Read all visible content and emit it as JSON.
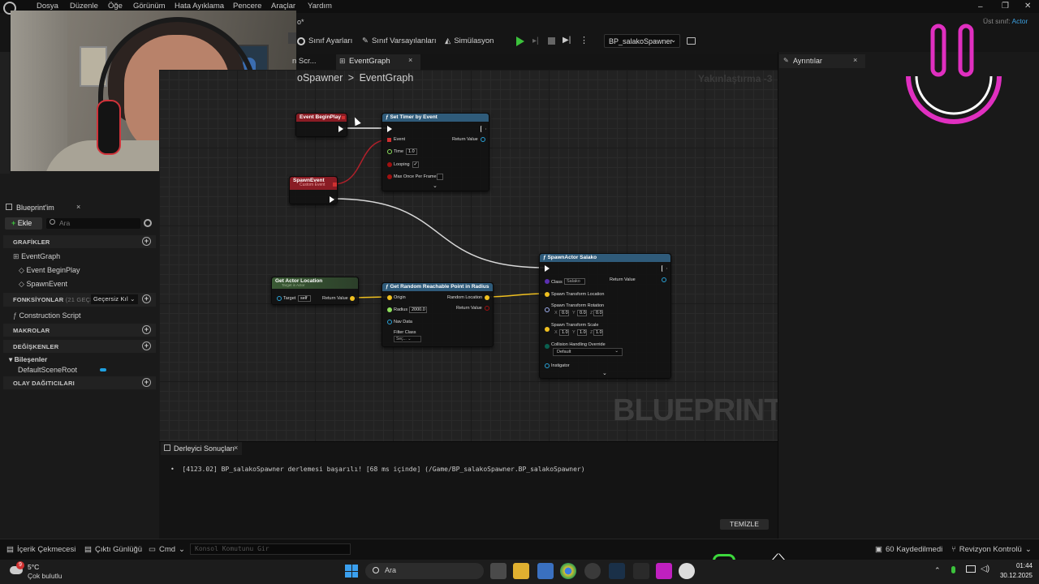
{
  "menu": [
    "Dosya",
    "Düzenle",
    "Öğe",
    "Görünüm",
    "Hata Ayıklama",
    "Pencere",
    "Araçlar",
    "Yardım"
  ],
  "parent_class": {
    "label": "Üst sınıf:",
    "value": "Actor"
  },
  "toolbar": {
    "class_settings": "Sınıf Ayarları",
    "class_defaults": "Sınıf Varsayılanları",
    "simulation": "Simülasyon",
    "blueprint_selector": "BP_salakoSpawner",
    "tab_title_partial": "o*"
  },
  "tabs": {
    "construction_partial": "n Scr...",
    "event_graph": "EventGraph",
    "details": "Ayrıntılar"
  },
  "breadcrumb": {
    "root": "oSpawner",
    "sep": ">",
    "current": "EventGraph"
  },
  "zoom_label": "Yakınlaştırma -3",
  "watermark": "BLUEPRINT",
  "my_blueprint": {
    "title": "Blueprint'im",
    "add_button": "Ekle",
    "search_placeholder": "Ara",
    "sections": {
      "graphs": "GRAFİKLER",
      "functions": "FONKSİYONLAR",
      "functions_count": "(21 GEÇERSİ",
      "override": "Geçersiz Kıl",
      "macros": "MAKROLAR",
      "variables": "DEĞİŞKENLER",
      "components": "Bileşenler",
      "dispatchers": "OLAY DAĞITICILARI"
    },
    "graph_items": [
      "EventGraph",
      "Event BeginPlay",
      "SpawnEvent"
    ],
    "function_items": [
      "Construction Script"
    ],
    "component_items": [
      "DefaultSceneRoot"
    ]
  },
  "nodes": {
    "begin_play": {
      "title": "Event BeginPlay"
    },
    "set_timer": {
      "title": "Set Timer by Event",
      "event": "Event",
      "time": "Time",
      "time_val": "1.0",
      "looping": "Looping",
      "max_once": "Max Once Per Frame",
      "return": "Return Value"
    },
    "spawn_event": {
      "title": "SpawnEvent",
      "subtitle": "Custom Event"
    },
    "get_actor_loc": {
      "title": "Get Actor Location",
      "subtitle": "Target is Actor",
      "target": "Target",
      "self": "self",
      "return": "Return Value"
    },
    "random_point": {
      "title": "Get Random Reachable Point in Radius",
      "origin": "Origin",
      "radius": "Radius",
      "radius_val": "2000.0",
      "nav_data": "Nav Data",
      "filter": "Filter Class",
      "filter_val": "Seç...",
      "random_loc": "Random Location",
      "return": "Return Value"
    },
    "spawn_actor": {
      "title": "SpawnActor Salako",
      "class": "Class",
      "class_val": "Salako",
      "loc": "Spawn Transform Location",
      "rot": "Spawn Transform Rotation",
      "scale": "Spawn Transform Scale",
      "rot_vals": [
        "0.0",
        "0.0",
        "0.0"
      ],
      "scale_vals": [
        "1.0",
        "1.0",
        "1.0"
      ],
      "axes": [
        "X",
        "Y",
        "Z"
      ],
      "collision": "Collision Handling Override",
      "collision_val": "Default",
      "instigator": "Instigator",
      "return": "Return Value"
    }
  },
  "compiler": {
    "title": "Derleyici Sonuçları",
    "message": "[4123.02] BP_salakoSpawner derlemesi başarılı! [68 ms içinde] (/Game/BP_salakoSpawner.BP_salakoSpawner)",
    "clear_button": "TEMİZLE"
  },
  "statusbar": {
    "content_drawer": "İçerik Çekmecesi",
    "output_log": "Çıktı Günlüğü",
    "cmd": "Cmd",
    "console_placeholder": "Konsol Komutunu Gir",
    "unsaved": "60 Kaydedilmedi",
    "revision": "Revizyon Kontrolü"
  },
  "taskbar": {
    "weather_temp": "5°C",
    "weather_desc": "Çok bulutlu",
    "weather_badge": "9",
    "search": "Ara",
    "time": "01:44",
    "date": "30.12.2025"
  },
  "colors": {
    "accent": "#1fa0e0",
    "event_red": "#8a1c24",
    "function_blue": "#2f5b7a",
    "pure_green": "#3a5a34",
    "exec_white": "#ffffff",
    "vector_yellow": "#f0c020",
    "object_blue": "#29a3d8",
    "bool_red": "#a01010",
    "float_green": "#8ee05c",
    "overlay_pink": "#e02fc0"
  }
}
